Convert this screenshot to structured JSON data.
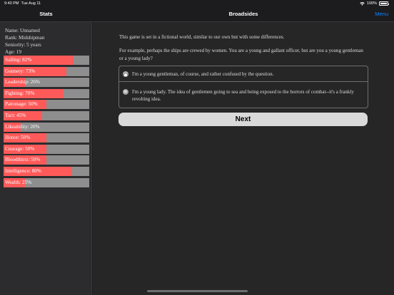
{
  "status_bar": {
    "time": "9:40 PM",
    "date": "Tue Aug 11",
    "battery": "100%",
    "icons": [
      "wifi-icon",
      "battery-icon"
    ]
  },
  "nav": {
    "sidebar_title": "Stats",
    "title": "Broadsides",
    "menu_label": "Menu",
    "accent_color": "#0a84ff"
  },
  "stats": {
    "name": "Name: Unnamed",
    "rank": "Rank: Midshipman",
    "seniority": "Seniority: 5 years",
    "age": "Age: 19",
    "fill_color": "#ff5a5a",
    "track_color": "#8e8e8e",
    "bars": [
      {
        "label": "Sailing: 82%",
        "value": 82
      },
      {
        "label": "Gunnery: 73%",
        "value": 73
      },
      {
        "label": "Leadership: 26%",
        "value": 26
      },
      {
        "label": "Fighting: 70%",
        "value": 70
      },
      {
        "label": "Patronage: 50%",
        "value": 50
      },
      {
        "label": "Tact: 45%",
        "value": 45
      },
      {
        "label": "Likeability: 20%",
        "value": 20
      },
      {
        "label": "Honor: 50%",
        "value": 50
      },
      {
        "label": "Courage: 50%",
        "value": 50
      },
      {
        "label": "Bloodthirst: 50%",
        "value": 50
      },
      {
        "label": "Intelligence: 80%",
        "value": 80
      },
      {
        "label": "Wealth: 25%",
        "value": 25
      }
    ]
  },
  "story": {
    "paragraph1": "This game is set in a fictional world, similar to our own but with some differences.",
    "paragraph2": "For example, perhaps the ships are crewed by women. You are a young and gallant officer, but are you a young gentleman or a young lady?",
    "choices": [
      {
        "text": "I'm a young gentleman, of course, and rather confused by the question.",
        "selected": true
      },
      {
        "text": "I'm a young lady. The idea of gentlemen going to sea and being exposed to the horrors of combat--it's a frankly revolting idea.",
        "selected": false
      }
    ],
    "next_label": "Next"
  }
}
